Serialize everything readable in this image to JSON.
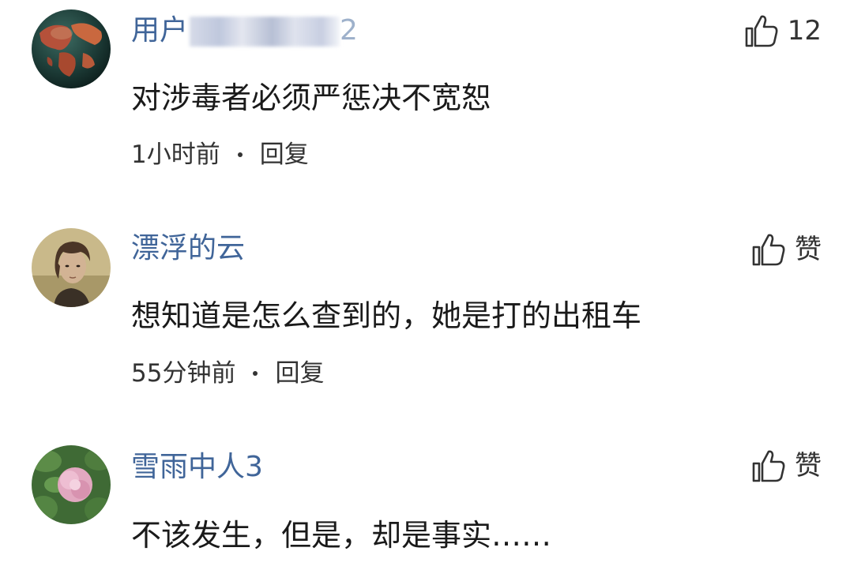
{
  "comments": [
    {
      "username_visible": "用户",
      "username_tail": "2",
      "avatar": "globe-avatar",
      "like_count": "12",
      "content": "对涉毒者必须严惩决不宽恕",
      "time": "1小时前",
      "reply": "回复"
    },
    {
      "username": "漂浮的云",
      "avatar": "person-avatar",
      "like_label": "赞",
      "content": "想知道是怎么查到的，她是打的出租车",
      "time": "55分钟前",
      "reply": "回复"
    },
    {
      "username": "雪雨中人3",
      "avatar": "flower-avatar",
      "like_label": "赞",
      "content": "不该发生，但是，却是事实……"
    }
  ],
  "colors": {
    "username": "#406599",
    "content": "#1a1a1a",
    "meta": "#333333"
  },
  "icons": [
    "thumbs-up-icon"
  ]
}
